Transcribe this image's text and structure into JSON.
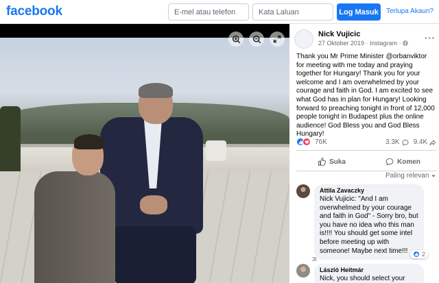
{
  "header": {
    "logo": "facebook",
    "email_placeholder": "E-mel atau telefon",
    "password_placeholder": "Kata Laluan",
    "login_label": "Log Masuk",
    "forgot_label": "Terlupa Akaun?"
  },
  "photo": {
    "controls": [
      "zoom-in-icon",
      "zoom-out-icon",
      "expand-icon"
    ]
  },
  "post": {
    "author": "Nick Vujicic",
    "meta": "27 Oktober 2019 · Instagram ·",
    "text": "Thank you Mr Prime Minister @orbanviktor for meeting with me today and praying together for Hungary! Thank you for your welcome and I am overwhelmed by your courage and faith in God. I am excited to see what God has in plan for Hungary! Looking forward to preaching tonight in front of 12,000 people tonight in Budapest plus the online audience! God Bless you and God Bless Hungary!",
    "reaction_count": "76K",
    "comment_count": "3.3K",
    "share_count": "9.4K",
    "like_label": "Suka",
    "comment_label": "Komen",
    "sort_label": "Paling relevan"
  },
  "comments": [
    {
      "name": "Attila Zavaczky",
      "text": "Nick Vujicic: \"And I am overwhelmed by your courage and faith in God\" - Sorry bro, but you have no idea who this man is!!!! You should get some intel before meeting up with someone! Maybe next time!!!",
      "time": "3t",
      "reactions": "2"
    },
    {
      "name": "László Heitmár",
      "text": "Nick, you should select your"
    }
  ],
  "colors": {
    "brand": "#1877f2",
    "love": "#f33e58",
    "muted": "#65676b"
  }
}
